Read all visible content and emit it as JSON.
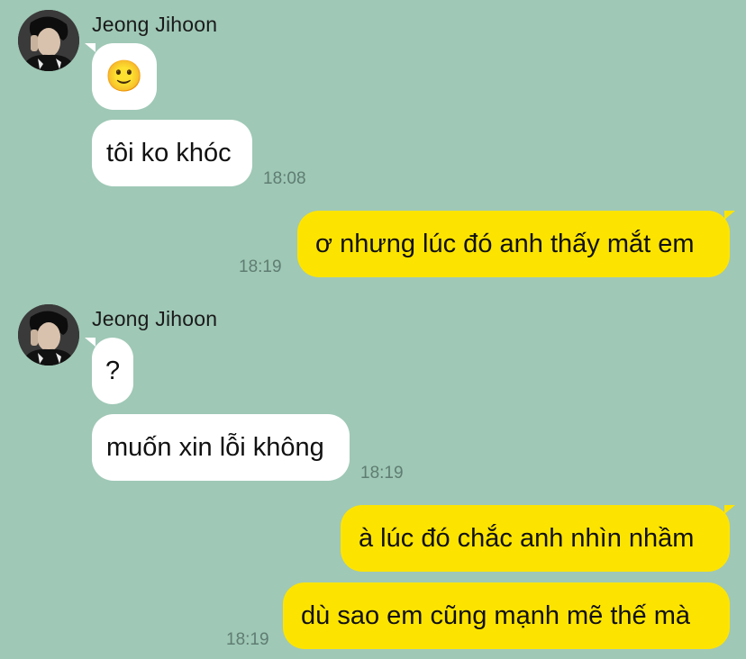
{
  "colors": {
    "background": "#9fc8b6",
    "incoming_bubble": "#ffffff",
    "outgoing_bubble": "#fde400",
    "timestamp": "#5f7d72"
  },
  "groups": [
    {
      "sender": "Jeong Jihoon",
      "avatar_icon": "profile-photo",
      "messages": [
        {
          "text": "🙂"
        },
        {
          "text": "tôi ko khóc",
          "time": "18:08"
        }
      ]
    },
    {
      "sender": "me",
      "messages": [
        {
          "text": "ơ nhưng lúc đó anh thấy mắt em",
          "time": "18:19"
        }
      ]
    },
    {
      "sender": "Jeong Jihoon",
      "avatar_icon": "profile-photo",
      "messages": [
        {
          "text": "?"
        },
        {
          "text": "muốn xin lỗi không",
          "time": "18:19"
        }
      ]
    },
    {
      "sender": "me",
      "messages": [
        {
          "text": "à lúc đó chắc anh nhìn nhầm"
        },
        {
          "text": "dù sao em cũng mạnh mẽ thế mà",
          "time": "18:19"
        }
      ]
    }
  ]
}
